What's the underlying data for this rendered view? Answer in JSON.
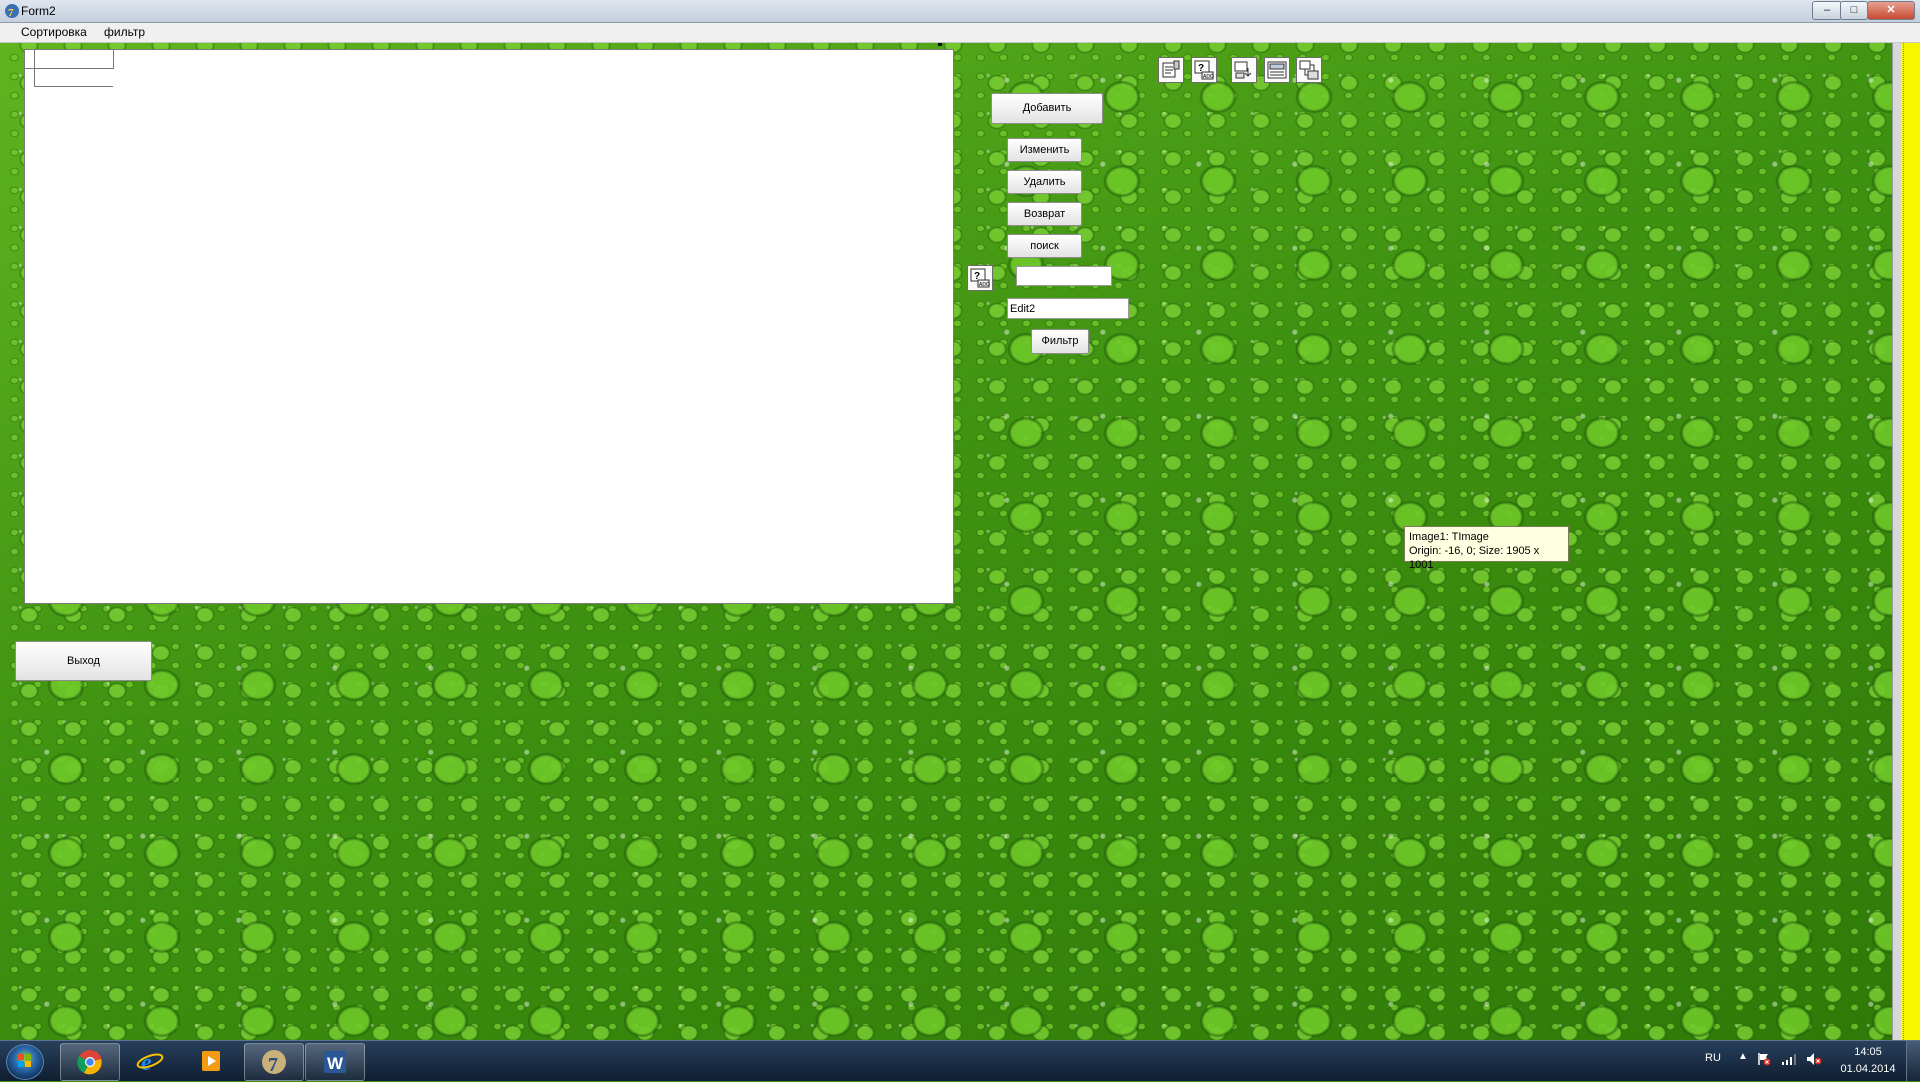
{
  "window": {
    "title": "Form2",
    "min_glyph": "–",
    "max_glyph": "□",
    "close_glyph": "✕"
  },
  "menu": {
    "items": [
      {
        "label": "Сортировка"
      },
      {
        "label": "фильтр"
      }
    ]
  },
  "form": {
    "buttons": {
      "add": "Добавить",
      "edit": "Изменить",
      "delete": "Удалить",
      "return": "Возврат",
      "search": "поиск",
      "filter": "Фильтр",
      "exit": "Выход"
    },
    "edit1_value": "",
    "edit2_value": "Edit2",
    "components": [
      "table-component-icon",
      "ado-query-icon",
      "data-source-icon",
      "ado-table-icon",
      "ado-connection-icon",
      "ado-query-icon"
    ],
    "background": "green-water-drops-image"
  },
  "tooltip": {
    "line1": "Image1: TImage",
    "line2": "Origin: -16, 0; Size: 1905 x 1001"
  },
  "taskbar": {
    "apps": [
      "start-orb-icon",
      "chrome-icon",
      "internet-explorer-icon",
      "media-player-icon",
      "delphi-icon",
      "word-icon"
    ],
    "word_letter": "W",
    "delphi_letter": "7",
    "tray": {
      "language": "RU",
      "time": "14:05",
      "date": "01.04.2014",
      "arrow": "▲"
    }
  },
  "colors": {
    "form_green": "#4a9e17",
    "yellow_strip": "#f6f600",
    "tooltip_bg": "#ffffe1",
    "taskbar_dark": "#0f1e31"
  }
}
